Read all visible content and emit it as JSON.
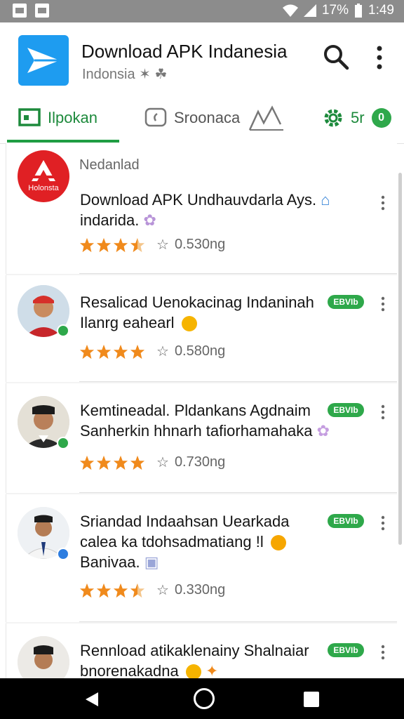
{
  "status_bar": {
    "battery": "17%",
    "time": "1:49"
  },
  "header": {
    "title": "Download APK Indanesia",
    "subtitle": "Indonsia ✶ ☘"
  },
  "tabs": [
    {
      "label": "Ilpokan",
      "icon": "screen-icon",
      "active": true
    },
    {
      "label": "Sroonaca",
      "icon": "chat-icon",
      "active": false
    },
    {
      "label": "",
      "icon": "chart-icon",
      "active": false
    },
    {
      "label": "5r",
      "icon": "gear-icon",
      "badge": "0",
      "active": false
    }
  ],
  "cards": [
    {
      "meta": "Nedanlad",
      "avatar_type": "logo",
      "logo_text": "Holonsta",
      "title": "Download APK Undhauvdarla Ays.",
      "title2": "indarida.",
      "tag": "",
      "stars": 3.5,
      "rating_text": "0.530ng"
    },
    {
      "meta": "",
      "avatar_type": "person-red",
      "title": "Resalicad Uenokacinag Indaninah",
      "title2": "Ilanrg eahearl",
      "tag": "EBVIb",
      "stars": 4,
      "rating_text": "0.580ng"
    },
    {
      "meta": "",
      "avatar_type": "person-cap",
      "title": "Kemtineadal. Pldankans Agdnaim",
      "title2": "Sanherkin hhnarh tafiorhamahaka",
      "tag": "EBVIb",
      "stars": 4,
      "rating_text": "0.730ng"
    },
    {
      "meta": "",
      "avatar_type": "person-white",
      "title": "Sriandad Indaahsan Uearkada",
      "title2": "calea ka tdohsadmatiang !l",
      "title3": "Banivaa.",
      "tag": "EBVIb",
      "stars": 3.5,
      "rating_text": "0.330ng"
    },
    {
      "meta": "",
      "avatar_type": "person-cap2",
      "title": "Rennload atikaklenainy Shalnaiar",
      "title2": "bnorenakadna",
      "tag": "EBVIb",
      "stars": 0,
      "rating_text": ""
    }
  ],
  "colors": {
    "accent": "#1f9d43",
    "star": "#f08a1c",
    "app_logo": "#1e9cf0",
    "logo_red": "#e02024"
  }
}
